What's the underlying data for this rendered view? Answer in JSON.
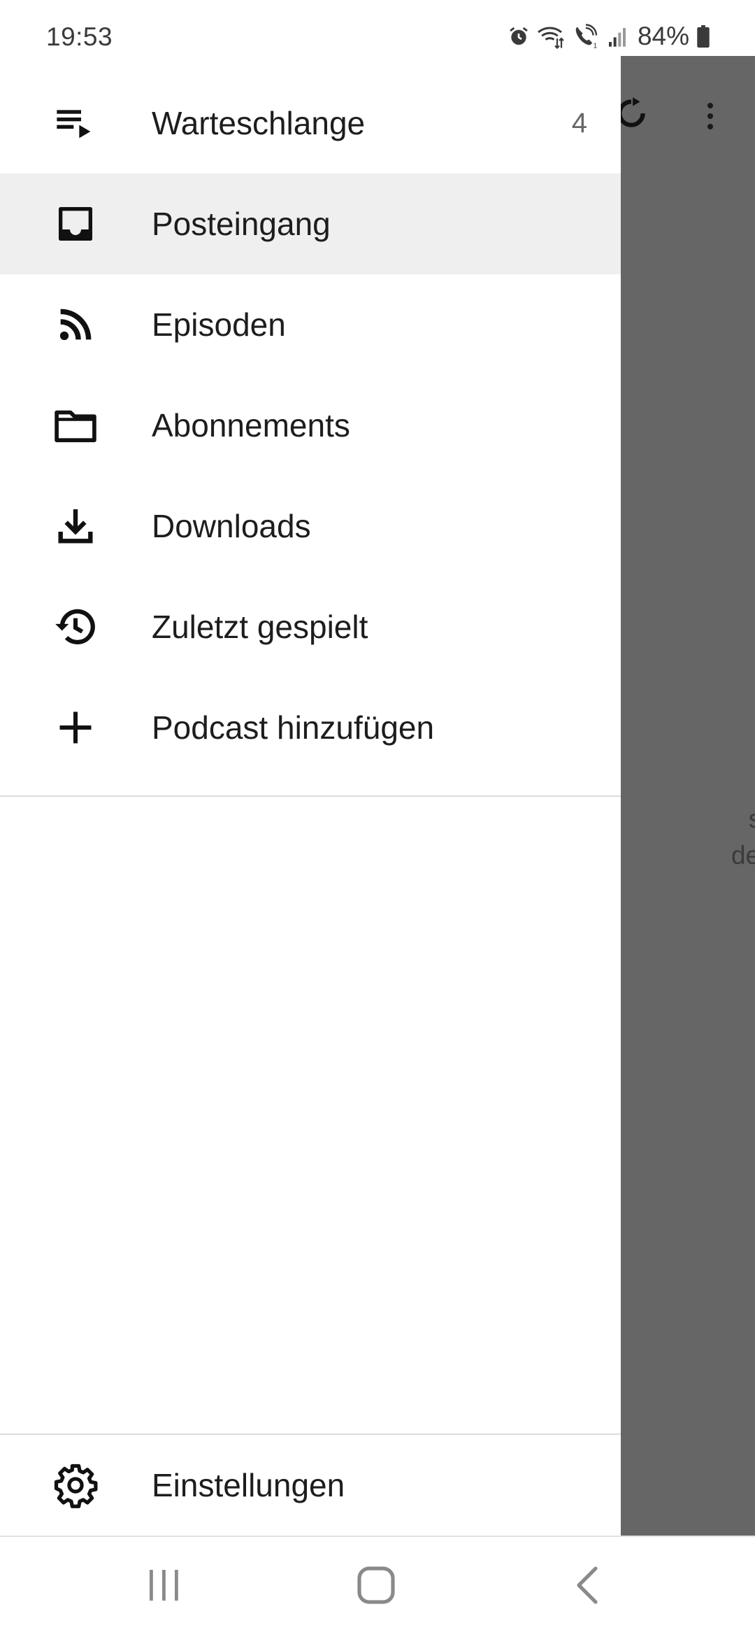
{
  "status_bar": {
    "time": "19:53",
    "battery": "84%",
    "icons": [
      "alarm-icon",
      "wifi-icon",
      "wifi-calling-icon",
      "signal-icon",
      "battery-icon"
    ]
  },
  "drawer": {
    "items": [
      {
        "label": "Warteschlange",
        "icon": "queue-icon",
        "badge": "4",
        "selected": false
      },
      {
        "label": "Posteingang",
        "icon": "inbox-icon",
        "selected": true
      },
      {
        "label": "Episoden",
        "icon": "rss-icon",
        "selected": false
      },
      {
        "label": "Abonnements",
        "icon": "folder-icon",
        "selected": false
      },
      {
        "label": "Downloads",
        "icon": "download-icon",
        "selected": false
      },
      {
        "label": "Zuletzt gespielt",
        "icon": "history-icon",
        "selected": false
      },
      {
        "label": "Podcast hinzufügen",
        "icon": "plus-icon",
        "selected": false
      }
    ],
    "footer": {
      "label": "Einstellungen",
      "icon": "gear-icon"
    }
  },
  "background": {
    "partial_text": "sie\nden,\n."
  },
  "nav_bar": {
    "buttons": [
      "recent-apps-icon",
      "home-icon",
      "back-icon"
    ]
  },
  "colors": {
    "scrim": "#666666",
    "selected_item": "#efefef",
    "text": "#1d1d1d"
  }
}
